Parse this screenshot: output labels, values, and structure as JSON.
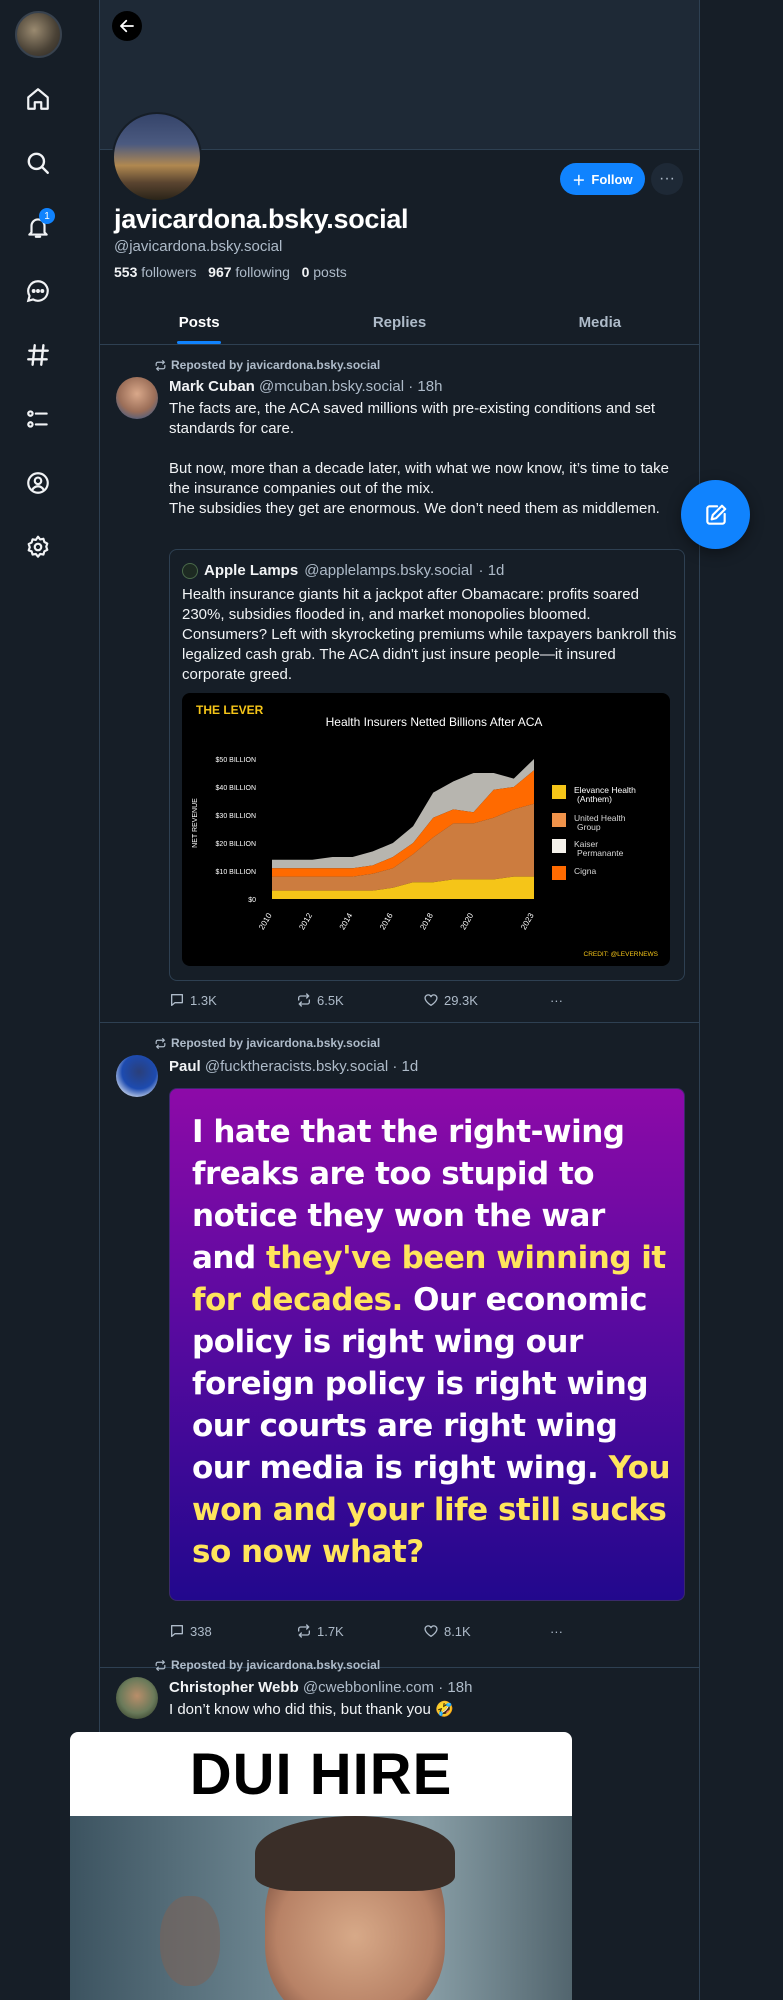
{
  "nav": {
    "notification_count": "1"
  },
  "profile": {
    "display_name": "javicardona.bsky.social",
    "handle": "@javicardona.bsky.social",
    "followers_count": "553",
    "followers_label": "followers",
    "following_count": "967",
    "following_label": "following",
    "posts_count": "0",
    "posts_label": "posts",
    "follow_label": "Follow",
    "more_label": "···"
  },
  "tabs": [
    {
      "label": "Posts",
      "active": true
    },
    {
      "label": "Replies",
      "active": false
    },
    {
      "label": "Media",
      "active": false
    }
  ],
  "posts": [
    {
      "repost_label": "Reposted by javicardona.bsky.social",
      "author": "Mark Cuban",
      "handle": "@mcuban.bsky.social",
      "time": "· 18h",
      "text": "The facts are, the ACA saved millions with pre-existing conditions and set standards for care.\n\nBut now, more than a decade later, with what we now know, it’s time to take the insurance companies out of the mix.\nThe subsidies they get are enormous. We don’t need them as middlemen.",
      "quote": {
        "author": "Apple Lamps",
        "handle": "@applelamps.bsky.social",
        "time": "· 1d",
        "text": "Health insurance giants hit a jackpot after Obamacare: profits soared 230%, subsidies flooded in, and market monopolies bloomed. Consumers? Left with skyrocketing premiums while taxpayers bankroll this legalized cash grab. The ACA didn't just insure people—it insured corporate greed."
      },
      "replies": "1.3K",
      "reposts": "6.5K",
      "likes": "29.3K"
    },
    {
      "repost_label": "Reposted by javicardona.bsky.social",
      "author": "Paul",
      "handle": "@fucktheracists.bsky.social",
      "time": "· 1d",
      "meme": {
        "part1": "I hate that the right-wing freaks are too stupid to notice they won the war and ",
        "part2": "they've been winning it for decades.",
        "part3": " Our economic policy is right wing our foreign policy is right wing our courts are right wing our media is right wing. ",
        "part4": "You won and your life still sucks so now what?"
      },
      "replies": "338",
      "reposts": "1.7K",
      "likes": "8.1K"
    },
    {
      "repost_label": "Reposted by javicardona.bsky.social",
      "author": "Christopher Webb",
      "handle": "@cwebbonline.com",
      "time": "· 18h",
      "text": "I don’t know who did this, but thank you 🤣",
      "image_title": "DUI HIRE"
    }
  ],
  "chart_data": {
    "type": "area",
    "logo": "THE LEVER",
    "title": "Health Insurers Netted Billions After ACA",
    "ylabel": "NET REVENUE",
    "credit": "CREDIT: @LEVERNEWS",
    "x_ticks": [
      "2010",
      "2012",
      "2014",
      "2016",
      "2018",
      "2020",
      "2023"
    ],
    "y_ticks": [
      "$50 BILLION",
      "$40 BILLION",
      "$30 BILLION",
      "$20 BILLION",
      "$10 BILLION",
      "$0"
    ],
    "ylim": [
      0,
      50
    ],
    "x": [
      2010,
      2011,
      2012,
      2013,
      2014,
      2015,
      2016,
      2017,
      2018,
      2019,
      2020,
      2021,
      2022,
      2023
    ],
    "series": [
      {
        "name": "Elevance Health (Anthem)",
        "color": "#f5c518",
        "values": [
          3,
          3,
          3,
          3,
          3,
          3,
          4,
          6,
          6,
          7,
          7,
          7,
          8,
          8
        ]
      },
      {
        "name": "United Health Group",
        "color": "#f0924a",
        "values": [
          5,
          5,
          5,
          5,
          5,
          6,
          7,
          10,
          16,
          20,
          20,
          22,
          24,
          26
        ]
      },
      {
        "name": "Kaiser Permanante",
        "color": "#f4f1ea",
        "values": [
          3,
          3,
          3,
          4,
          4,
          5,
          5,
          6,
          9,
          10,
          14,
          6,
          3,
          4
        ]
      },
      {
        "name": "Cigna",
        "color": "#ff6a00",
        "values": [
          3,
          3,
          3,
          3,
          3,
          3,
          4,
          4,
          7,
          5,
          4,
          10,
          8,
          12
        ]
      }
    ]
  }
}
